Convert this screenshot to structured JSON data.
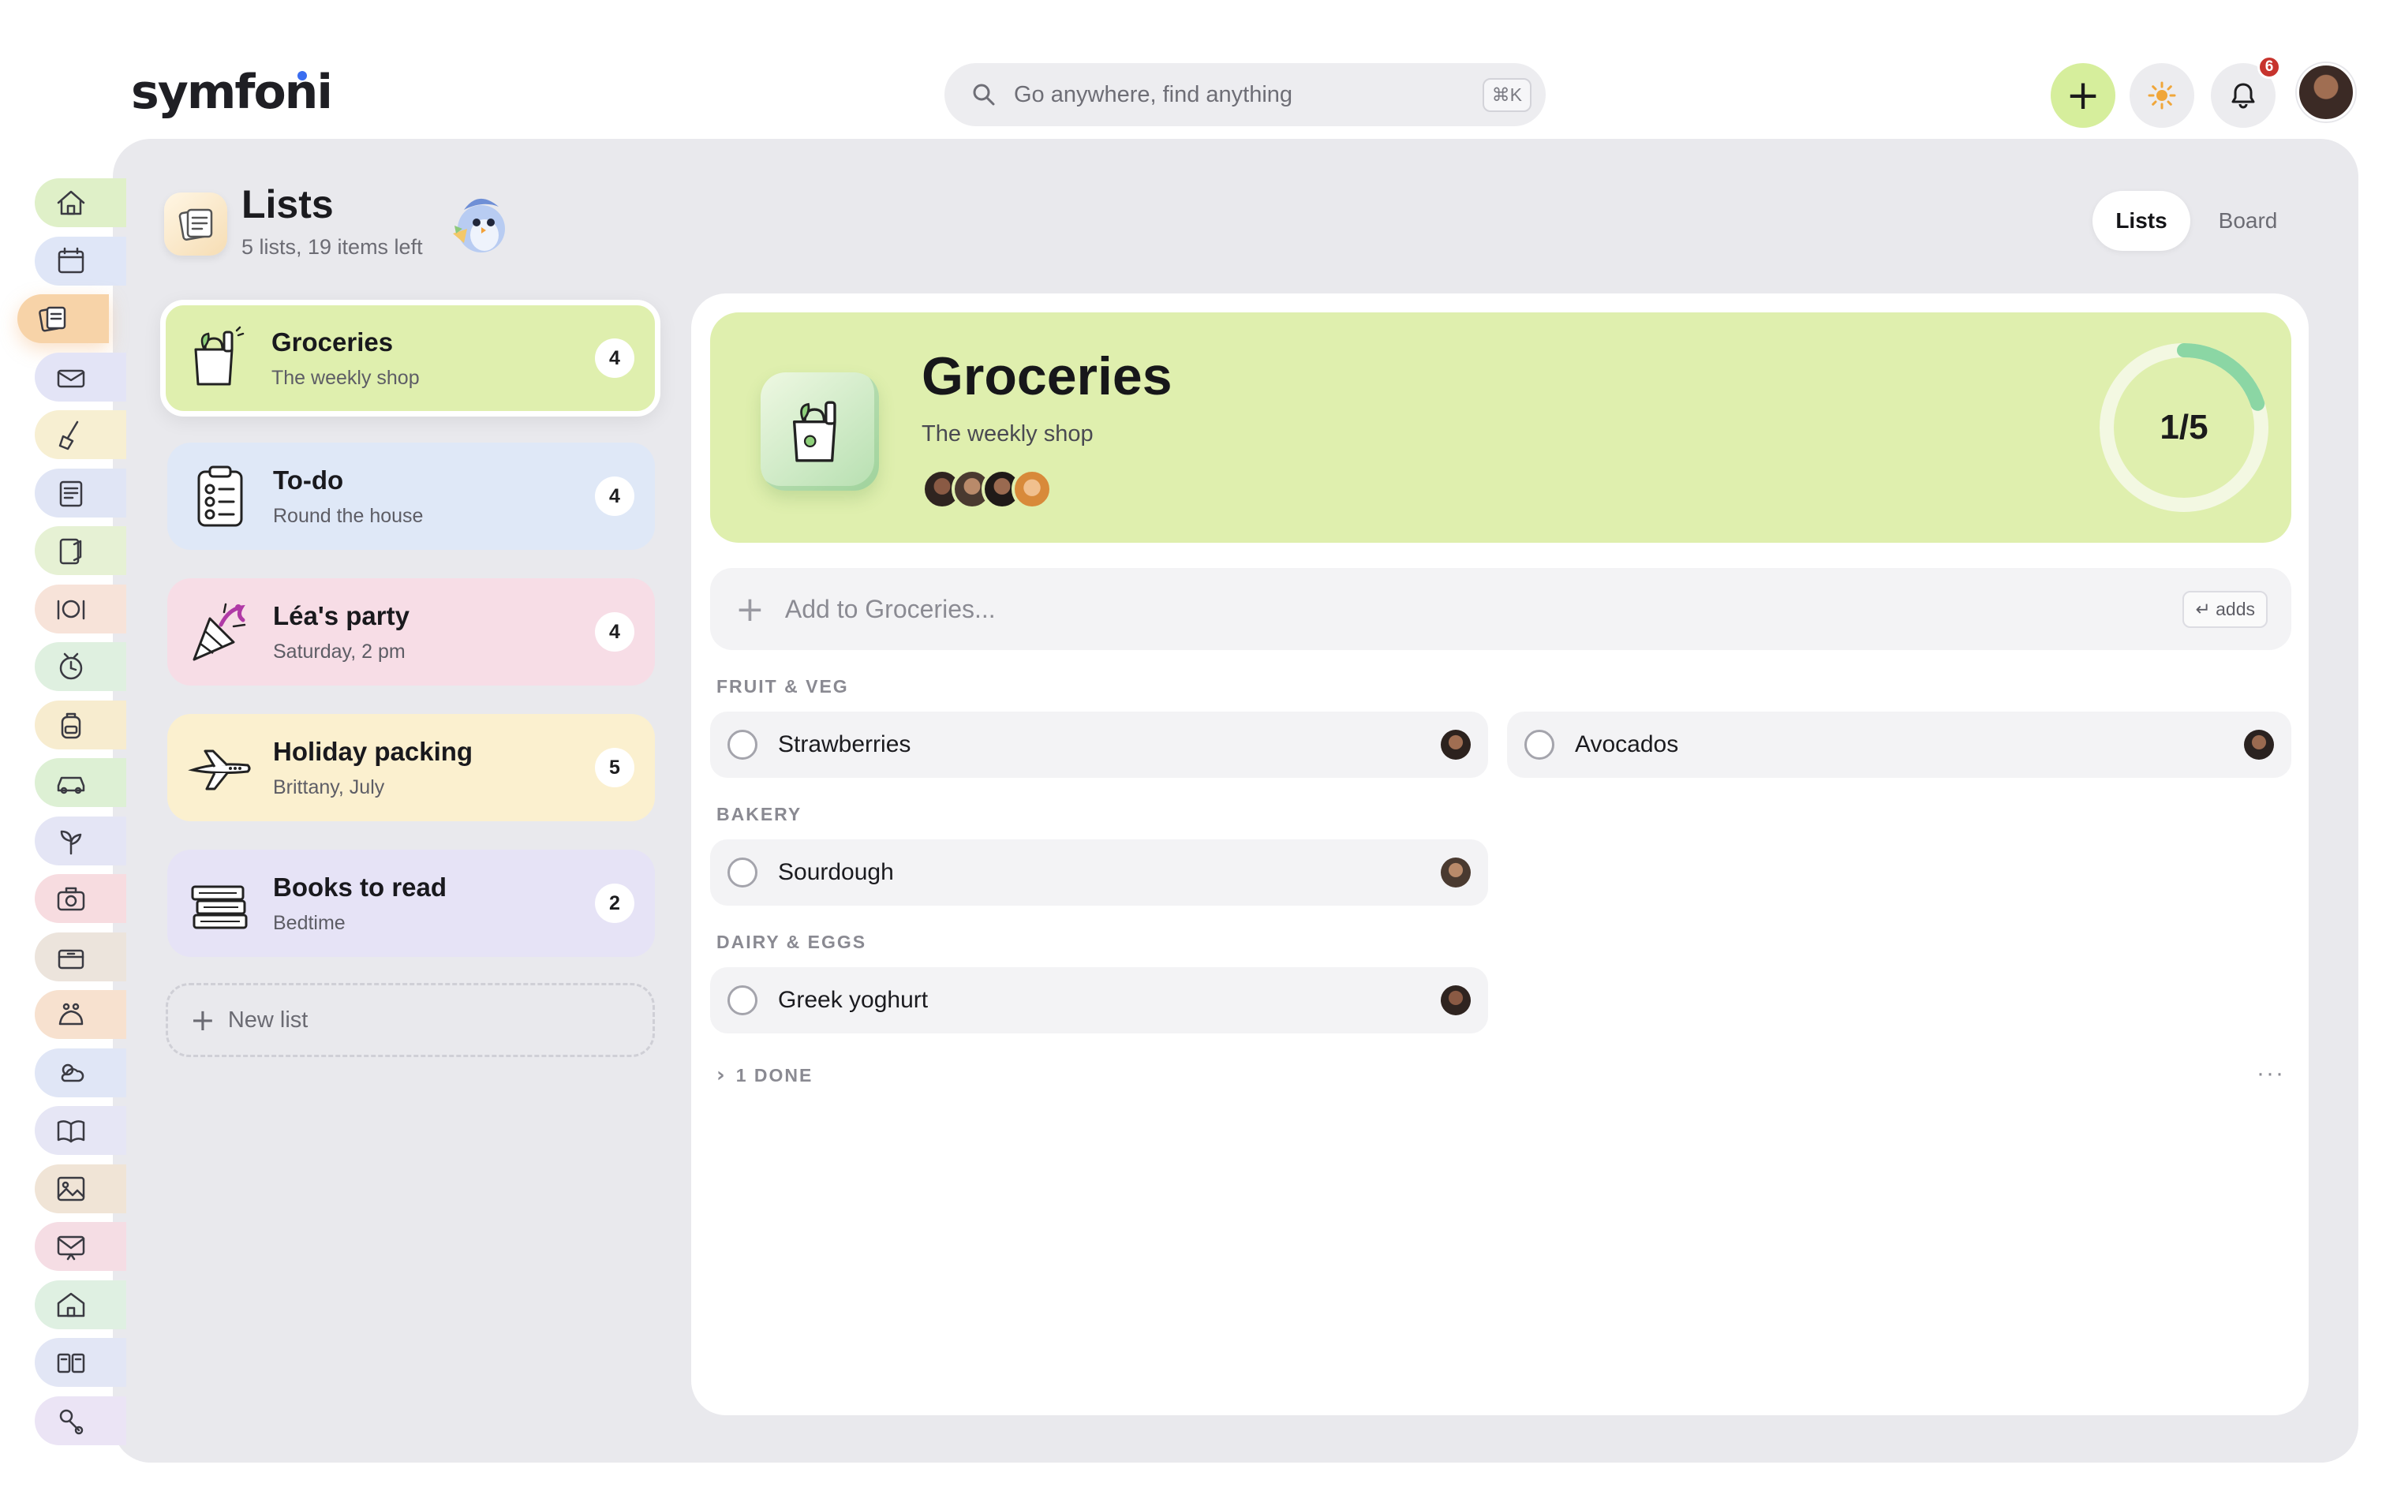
{
  "app": {
    "logo": "symfoni"
  },
  "search": {
    "placeholder": "Go anywhere, find anything",
    "shortcut": "⌘K"
  },
  "topbar": {
    "notifications_count": "6"
  },
  "rail": {
    "items": [
      {
        "icon": "home-icon",
        "color": "#dff0c8"
      },
      {
        "icon": "calendar-icon",
        "color": "#dfe6f7"
      },
      {
        "icon": "lists-icon",
        "color": "#f7d3a8",
        "active": true
      },
      {
        "icon": "mail-icon",
        "color": "#e3e4f6"
      },
      {
        "icon": "cleaning-icon",
        "color": "#f7efd2"
      },
      {
        "icon": "notes-icon",
        "color": "#e0e5f5"
      },
      {
        "icon": "recipes-icon",
        "color": "#e6f1d4"
      },
      {
        "icon": "meals-icon",
        "color": "#f7e3d9"
      },
      {
        "icon": "planner-icon",
        "color": "#dff0e0"
      },
      {
        "icon": "backpack-icon",
        "color": "#f7eccf"
      },
      {
        "icon": "car-icon",
        "color": "#ddf0d4"
      },
      {
        "icon": "garden-icon",
        "color": "#e4e5f5"
      },
      {
        "icon": "camera-icon",
        "color": "#f7dce0"
      },
      {
        "icon": "storage-icon",
        "color": "#ece4dc"
      },
      {
        "icon": "pets-icon",
        "color": "#f7e1cf"
      },
      {
        "icon": "weather-icon",
        "color": "#e0e6f6"
      },
      {
        "icon": "reading-icon",
        "color": "#e6e6f5"
      },
      {
        "icon": "photos-icon",
        "color": "#f0e4d6"
      },
      {
        "icon": "messages-icon",
        "color": "#f5dde4"
      },
      {
        "icon": "house-icon",
        "color": "#dff0e2"
      },
      {
        "icon": "library-icon",
        "color": "#e2e6f5"
      },
      {
        "icon": "toys-icon",
        "color": "#ebe4f5"
      }
    ]
  },
  "header": {
    "title": "Lists",
    "subtitle": "5 lists, 19 items left"
  },
  "view_toggle": {
    "lists": "Lists",
    "board": "Board"
  },
  "lists": [
    {
      "title": "Groceries",
      "subtitle": "The weekly shop",
      "count": "4",
      "color": "#dfefae"
    },
    {
      "title": "To-do",
      "subtitle": "Round the house",
      "count": "4",
      "color": "#dfe8f7"
    },
    {
      "title": "Léa's party",
      "subtitle": "Saturday, 2 pm",
      "count": "4",
      "color": "#f7dde6"
    },
    {
      "title": "Holiday packing",
      "subtitle": "Brittany, July",
      "count": "5",
      "color": "#fbf0cf"
    },
    {
      "title": "Books to read",
      "subtitle": "Bedtime",
      "count": "2",
      "color": "#e6e3f6"
    }
  ],
  "new_list": "New list",
  "detail": {
    "title": "Groceries",
    "subtitle": "The weekly shop",
    "progress_label": "1/5",
    "progress_fraction": 0.2,
    "add_placeholder": "Add to Groceries...",
    "add_hint": "↵ adds",
    "sections": [
      {
        "label": "FRUIT & VEG",
        "items": [
          "Strawberries",
          "Avocados"
        ]
      },
      {
        "label": "BAKERY",
        "items": [
          "Sourdough"
        ]
      },
      {
        "label": "DAIRY & EGGS",
        "items": [
          "Greek yoghurt"
        ]
      }
    ],
    "done_label": "1 DONE",
    "more": "···"
  }
}
